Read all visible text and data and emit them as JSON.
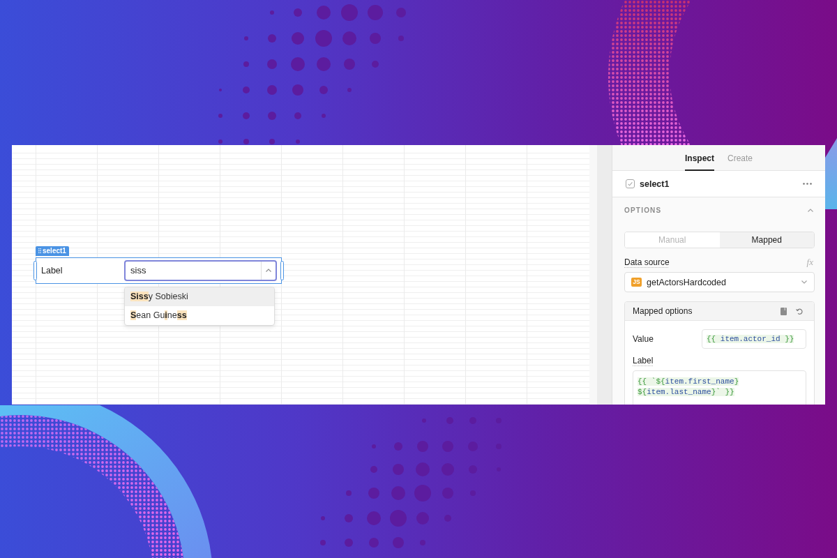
{
  "canvas": {
    "select": {
      "name_tag": "select1",
      "label": "Label",
      "value": "siss",
      "expanded": true,
      "options": [
        {
          "label": "**Siss**y Sobieski",
          "highlighted": true
        },
        {
          "label": "**S**ean Gu**i**ne**ss**",
          "highlighted": false
        }
      ]
    }
  },
  "inspector": {
    "tabs": [
      {
        "label": "Inspect",
        "selected": true
      },
      {
        "label": "Create",
        "selected": false
      }
    ],
    "component_name": "select1",
    "options_section": {
      "title": "OPTIONS",
      "expanded": true,
      "modes": [
        {
          "label": "Manual",
          "selected": false
        },
        {
          "label": "Mapped",
          "selected": true
        }
      ],
      "data_source": {
        "label": "Data source",
        "formula_toggle": "fx",
        "badge": "JS",
        "value": "getActorsHardcoded"
      },
      "mapped_options": {
        "title": "Mapped options",
        "fields": [
          {
            "kind": "inline",
            "label": "Value",
            "code": [
              [
                {
                  "kind": "delimiter",
                  "text": "{{ "
                },
                {
                  "kind": "variable",
                  "text": "item.actor_id"
                },
                {
                  "kind": "delimiter",
                  "text": " }}"
                }
              ]
            ]
          },
          {
            "kind": "block",
            "label": "Label",
            "code": [
              [
                {
                  "kind": "delimiter",
                  "text": "{{ `${"
                },
                {
                  "kind": "variable",
                  "text": "item.first_name"
                },
                {
                  "kind": "delimiter",
                  "text": "}"
                }
              ],
              [
                {
                  "kind": "delimiter",
                  "text": "${"
                },
                {
                  "kind": "variable",
                  "text": "item.last_name"
                },
                {
                  "kind": "delimiter",
                  "text": "}` }}"
                }
              ]
            ]
          }
        ]
      }
    }
  }
}
